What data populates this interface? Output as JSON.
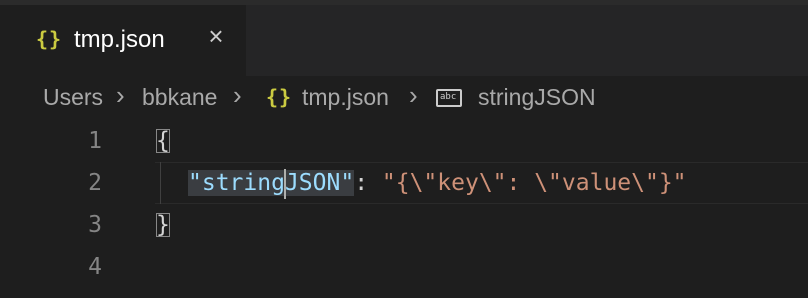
{
  "tab": {
    "icon": "{}",
    "label": "tmp.json",
    "close": "×"
  },
  "breadcrumb": {
    "items": [
      "Users",
      "bbkane",
      "tmp.json",
      "stringJSON"
    ],
    "separator": "›",
    "json_icon": "{}",
    "symbol_icon": "abc"
  },
  "editor": {
    "line_numbers": [
      "1",
      "2",
      "3",
      "4"
    ],
    "line1": "{",
    "line2": {
      "key_part1": "\"string",
      "key_part2": "JSON\"",
      "colon": ": ",
      "value": "\"{\\\"key\\\": \\\"value\\\"}\""
    },
    "line3": "}"
  },
  "colors": {
    "background": "#1e1e1e",
    "json_icon": "#cbcb41",
    "key": "#9cdcfe",
    "string": "#ce9178"
  }
}
